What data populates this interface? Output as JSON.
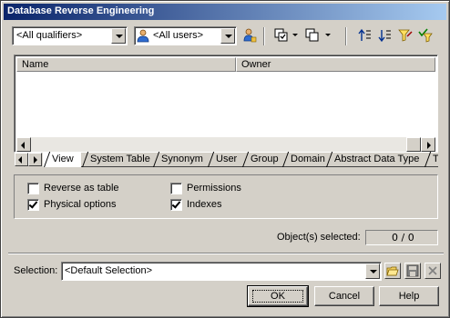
{
  "window": {
    "title": "Database Reverse Engineering"
  },
  "toolbar": {
    "qualifier_value": "<All qualifiers>",
    "user_value": "<All users>",
    "icons": [
      "select-user-icon",
      "select-all-icon",
      "deselect-all-icon",
      "move-up-icon",
      "move-down-icon",
      "filter-icon",
      "check-filter-icon"
    ]
  },
  "list": {
    "columns": [
      "Name",
      "Owner"
    ]
  },
  "tabs": [
    "View",
    "System Table",
    "Synonym",
    "User",
    "Group",
    "Domain",
    "Abstract Data Type",
    "T"
  ],
  "options": {
    "reverse_as_table": {
      "label": "Reverse as table",
      "checked": false
    },
    "physical_options": {
      "label": "Physical options",
      "checked": true
    },
    "permissions": {
      "label": "Permissions",
      "checked": false
    },
    "indexes": {
      "label": "Indexes",
      "checked": true
    }
  },
  "status": {
    "selected_label": "Object(s) selected:",
    "selected_value": "0 / 0"
  },
  "selection": {
    "label": "Selection:",
    "value": "<Default Selection>"
  },
  "buttons": {
    "ok": "OK",
    "cancel": "Cancel",
    "help": "Help"
  },
  "colors": {
    "title_start": "#0a246a",
    "title_end": "#a6caf0",
    "face": "#d4d0c8"
  }
}
